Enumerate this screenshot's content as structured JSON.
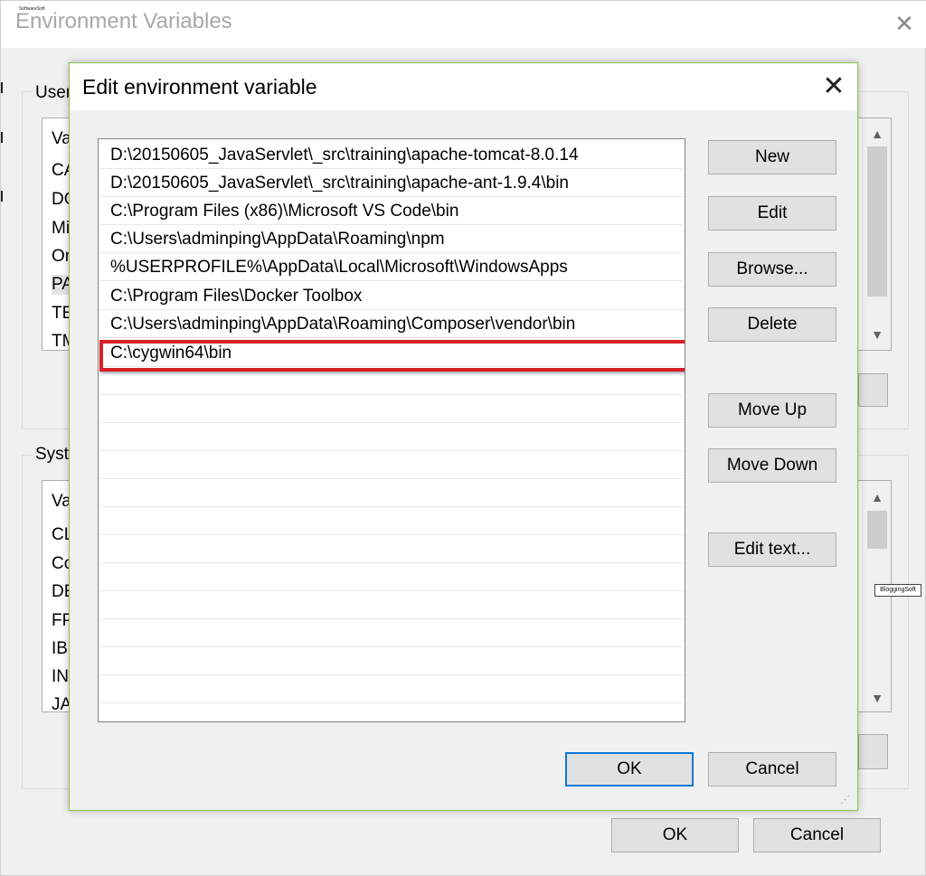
{
  "background_window": {
    "title": "Environment Variables",
    "logo_text": "SoftwareSoft",
    "close_glyph": "✕",
    "user_group": {
      "label": "User",
      "items": [
        "Va",
        "CA",
        "DO",
        "Mi",
        "On",
        "PA",
        "TE",
        "TM"
      ]
    },
    "system_group": {
      "label": "Syste",
      "items": [
        "Va",
        "CL",
        "Co",
        "DE",
        "FP",
        "IB",
        "IN",
        "JA"
      ]
    },
    "ok_label": "OK",
    "cancel_label": "Cancel",
    "side_logo_text": "BloggingSoft",
    "scroll_up_glyph": "▲",
    "scroll_down_glyph": "▼"
  },
  "dialog": {
    "title": "Edit environment variable",
    "close_glyph": "✕",
    "paths": [
      "D:\\20150605_JavaServlet\\_src\\training\\apache-tomcat-8.0.14",
      "D:\\20150605_JavaServlet\\_src\\training\\apache-ant-1.9.4\\bin",
      "C:\\Program Files (x86)\\Microsoft VS Code\\bin",
      "C:\\Users\\adminping\\AppData\\Roaming\\npm",
      "%USERPROFILE%\\AppData\\Local\\Microsoft\\WindowsApps",
      "C:\\Program Files\\Docker Toolbox",
      "C:\\Users\\adminping\\AppData\\Roaming\\Composer\\vendor\\bin",
      "C:\\cygwin64\\bin"
    ],
    "highlighted_path_index": 7,
    "highlight_color": "#d92027",
    "buttons": {
      "new": "New",
      "edit": "Edit",
      "browse": "Browse...",
      "delete": "Delete",
      "move_up": "Move Up",
      "move_down": "Move Down",
      "edit_text": "Edit text..."
    },
    "ok_label": "OK",
    "cancel_label": "Cancel",
    "grip_glyph": "⋰"
  },
  "colors": {
    "dialog_border": "#8fc34a",
    "primary_button_border": "#0a78d7",
    "button_face": "#e1e1e1"
  }
}
